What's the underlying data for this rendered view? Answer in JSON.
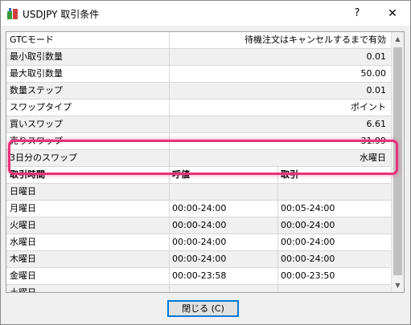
{
  "window": {
    "title": "USDJPY 取引条件",
    "help": "?",
    "close": "✕"
  },
  "properties": [
    {
      "key": "GTCモード",
      "value": "待機注文はキャンセルするまで有効"
    },
    {
      "key": "最小取引数量",
      "value": "0.01"
    },
    {
      "key": "最大取引数量",
      "value": "50.00"
    },
    {
      "key": "数量ステップ",
      "value": "0.01"
    },
    {
      "key": "スワップタイプ",
      "value": "ポイント"
    },
    {
      "key": "買いスワップ",
      "value": "6.61"
    },
    {
      "key": "売りスワップ",
      "value": "-31.99"
    },
    {
      "key": "3日分のスワップ",
      "value": "水曜日"
    }
  ],
  "schedule": {
    "headers": [
      "取引時間",
      "呼値",
      "取引"
    ],
    "rows": [
      {
        "day": "日曜日",
        "quotes": "",
        "trade": ""
      },
      {
        "day": "月曜日",
        "quotes": "00:00-24:00",
        "trade": "00:05-24:00"
      },
      {
        "day": "火曜日",
        "quotes": "00:00-24:00",
        "trade": "00:00-24:00"
      },
      {
        "day": "水曜日",
        "quotes": "00:00-24:00",
        "trade": "00:00-24:00"
      },
      {
        "day": "木曜日",
        "quotes": "00:00-24:00",
        "trade": "00:00-24:00"
      },
      {
        "day": "金曜日",
        "quotes": "00:00-23:58",
        "trade": "00:00-23:50"
      },
      {
        "day": "土曜日",
        "quotes": "",
        "trade": ""
      }
    ]
  },
  "buttons": {
    "close_label": "閉じる (C)"
  },
  "colors": {
    "highlight": "#e8317a",
    "focus_border": "#0078d7"
  }
}
